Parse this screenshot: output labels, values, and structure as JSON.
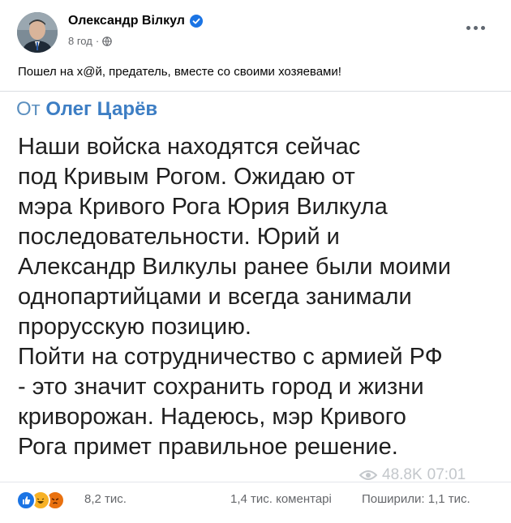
{
  "post": {
    "author": "Олександр Вілкул",
    "timestamp": "8 год",
    "meta_separator": "·",
    "verified_icon": "verified-badge-icon",
    "privacy_icon": "globe-icon",
    "caption": "Пошел на х@й, предатель, вместе со своими хозяевами!"
  },
  "image": {
    "from_prefix": "От",
    "from_name": "Олег Царёв",
    "body": "Наши войска находятся сейчас\nпод Кривым Рогом. Ожидаю от\nмэра Кривого Рога Юрия Вилкула\nпоследовательности. Юрий и\nАлександр Вилкулы ранее были моими\nоднопартийцами и всегда занимали\nпрорусскую позицию.\nПойти на сотрудничество с армией РФ\n- это значит сохранить город и жизни\nкриворожан. Надеюсь, мэр Кривого\nРога примет правильное решение.",
    "views": "48.8K",
    "time": "07:01"
  },
  "footer": {
    "reactions": [
      "like-icon",
      "haha-icon",
      "angry-icon"
    ],
    "reaction_count": "8,2 тис.",
    "comments": "1,4 тис. коментарі",
    "shares": "Поширили: 1,1 тис."
  },
  "colors": {
    "accent": "#1b74e4",
    "from_name": "#3d7ec4",
    "muted": "#65676b"
  }
}
